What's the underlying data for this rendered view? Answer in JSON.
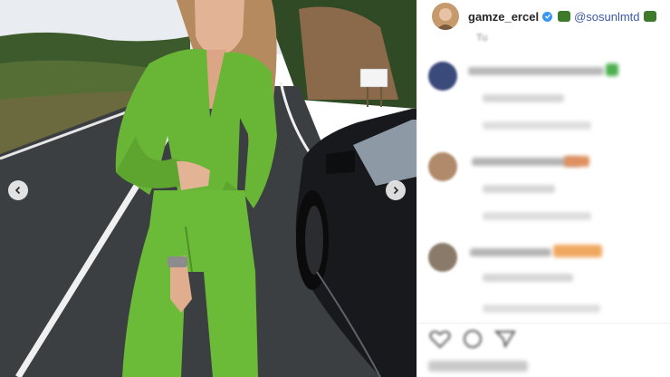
{
  "post": {
    "username": "gamze_ercel",
    "mention": "@sosunlmtd",
    "caption_snippet": "Tu",
    "verified_color": "#3897f0"
  },
  "icons": {
    "prev": "chevron-left-icon",
    "next": "chevron-right-icon",
    "verified": "verified-badge-icon",
    "like": "heart-icon",
    "comment": "comment-icon",
    "share": "share-icon"
  },
  "colors": {
    "jumpsuit": "#6fbf3a",
    "road": "#3a3d40",
    "sky": "#e8edf2",
    "car": "#17191c"
  }
}
